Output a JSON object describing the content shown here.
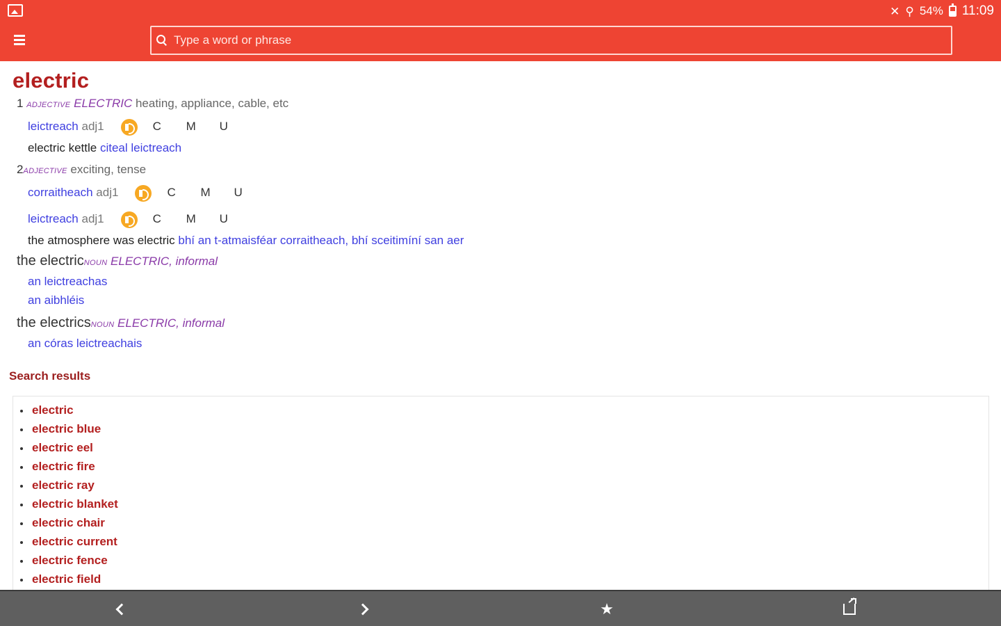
{
  "status_bar": {
    "battery": "54%",
    "time": "11:09",
    "icons": [
      "gallery-icon",
      "mute-icon",
      "wifi-icon",
      "battery-icon"
    ]
  },
  "search": {
    "placeholder": "Type a word or phrase"
  },
  "entry": {
    "headword": "electric",
    "senses": [
      {
        "number": "1",
        "pos": "adjective",
        "sense": "ELECTRIC",
        "gloss": "heating, appliance, cable, etc",
        "translations": [
          {
            "word": "leictreach",
            "pos": "adj1",
            "dialects": [
              "C",
              "M",
              "U"
            ]
          }
        ],
        "example": {
          "en": "electric kettle",
          "ga": "citeal leictreach"
        }
      },
      {
        "number": "2",
        "pos": "adjective",
        "gloss": "exciting, tense",
        "translations": [
          {
            "word": "corraitheach",
            "pos": "adj1",
            "dialects": [
              "C",
              "M",
              "U"
            ]
          },
          {
            "word": "leictreach",
            "pos": "adj1",
            "dialects": [
              "C",
              "M",
              "U"
            ]
          }
        ],
        "example": {
          "en": "the atmosphere was electric",
          "ga": "bhí an t-atmaisféar corraitheach, bhí sceitimíní san aer"
        }
      }
    ],
    "phrases": [
      {
        "phrase": "the electric",
        "pos": "noun",
        "sense": "ELECTRIC, informal",
        "translations": [
          "an leictreachas",
          "an aibhléis"
        ]
      },
      {
        "phrase": "the electrics",
        "pos": "noun",
        "sense": "ELECTRIC, informal",
        "translations": [
          "an córas leictreachais"
        ]
      }
    ]
  },
  "search_results": {
    "title": "Search results",
    "items": [
      "electric",
      "electric blue",
      "electric eel",
      "electric fire",
      "electric ray",
      "electric blanket",
      "electric chair",
      "electric current",
      "electric fence",
      "electric field"
    ]
  },
  "bottom_bar": {
    "icons": [
      "back-icon",
      "forward-icon",
      "star-icon",
      "share-icon"
    ]
  },
  "colors": {
    "app_bar": "#ee4433",
    "headword": "#b31f1f",
    "link": "#3f3fe0",
    "pos": "#8a3aa8",
    "audio": "#f7a823",
    "bottom_bar": "#5f5f5f"
  }
}
